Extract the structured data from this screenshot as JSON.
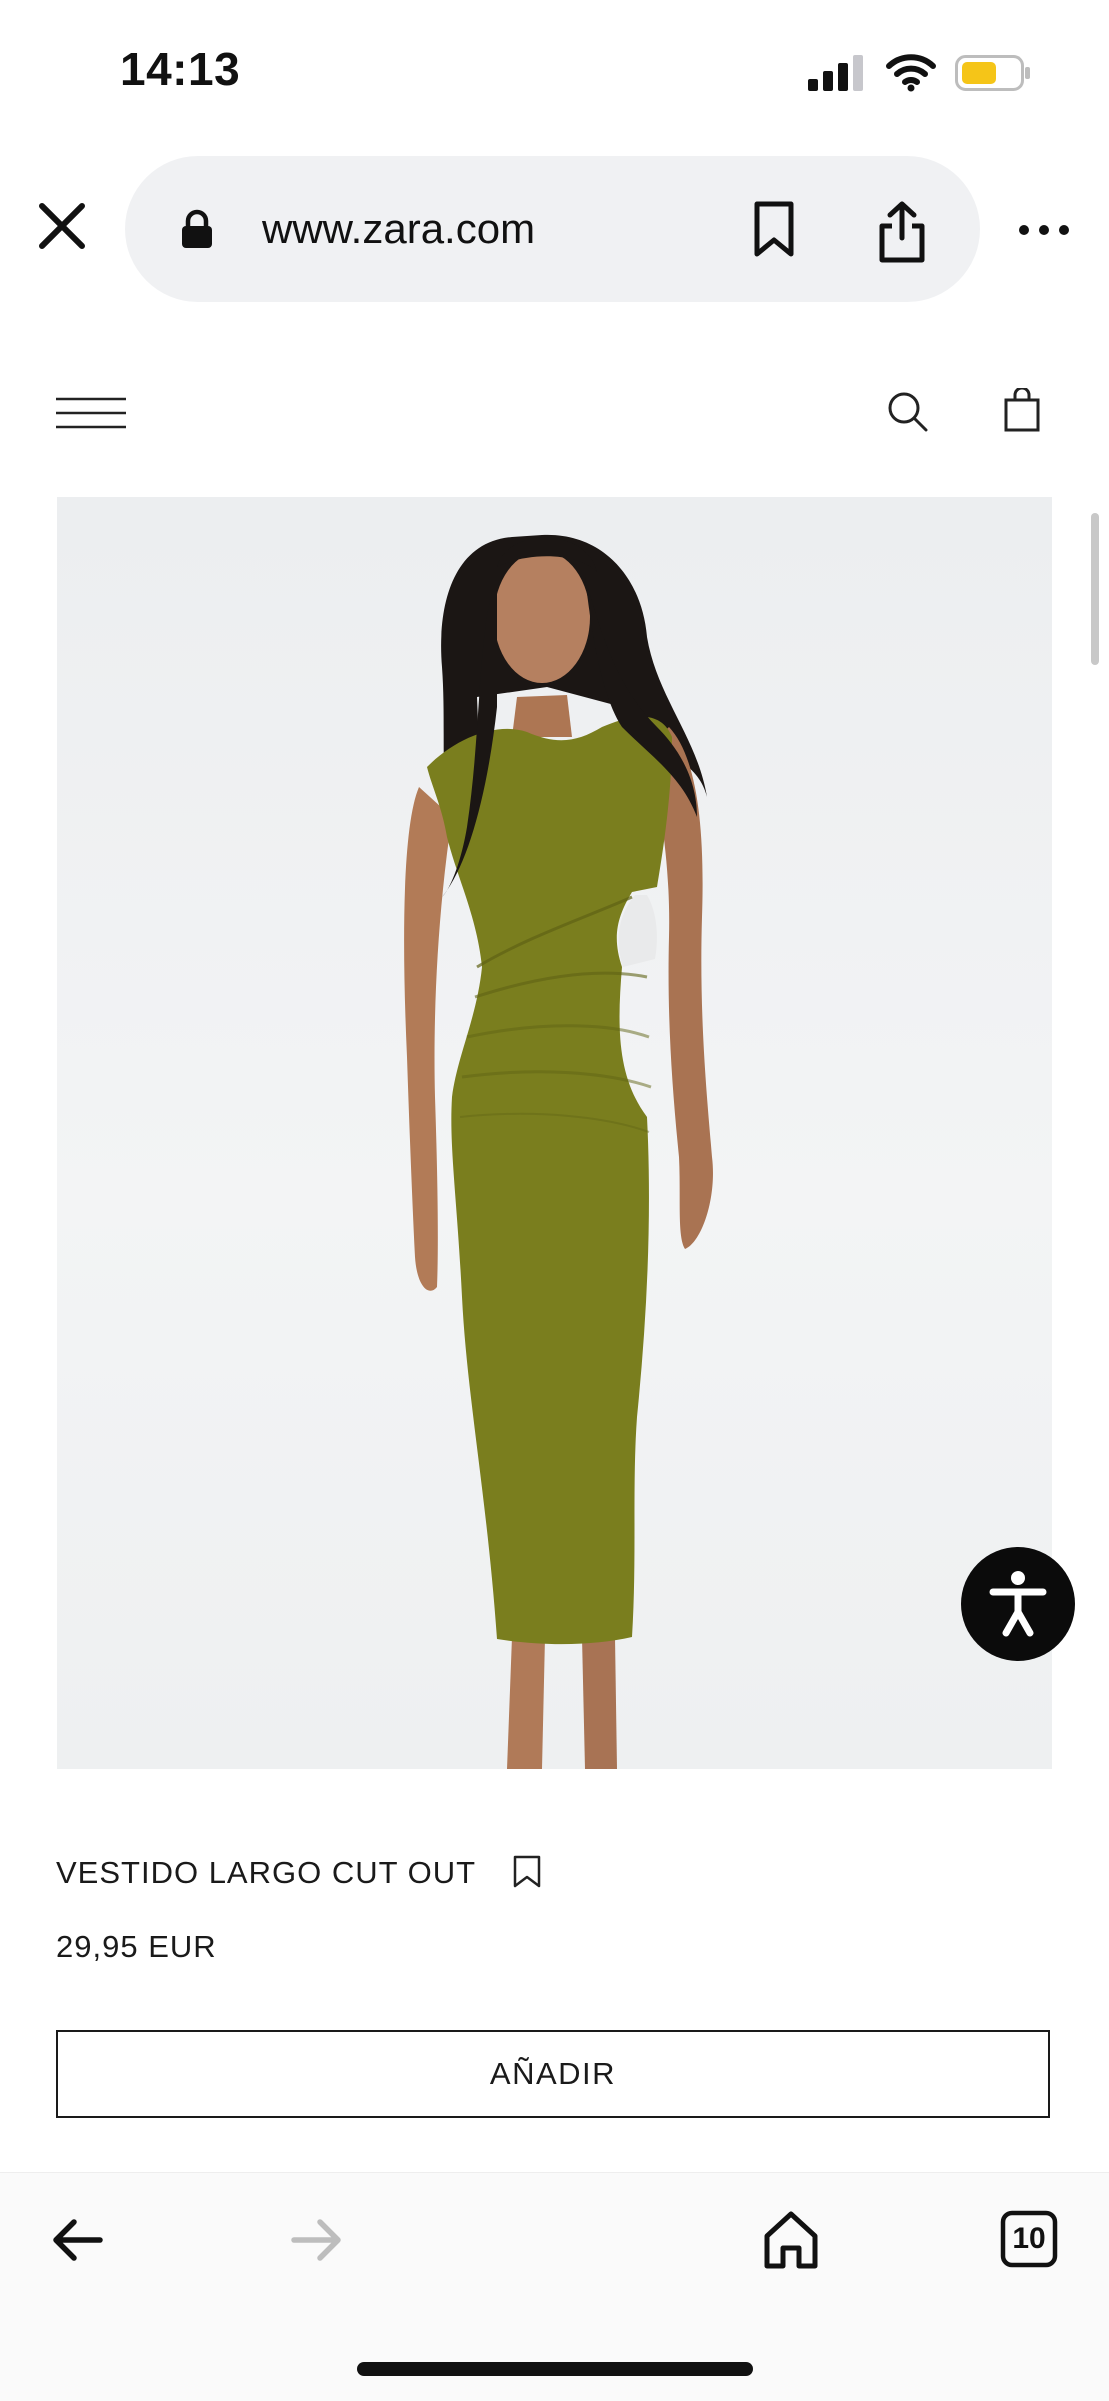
{
  "status_bar": {
    "time": "14:13",
    "battery_color": "#f5c518"
  },
  "browser": {
    "url": "www.zara.com",
    "icons": {
      "close": "close-icon",
      "lock": "lock-icon",
      "bookmark": "bookmark-icon",
      "share": "share-icon",
      "more": "more-icon"
    }
  },
  "site_header": {
    "icons": {
      "menu": "hamburger-menu-icon",
      "search": "search-icon",
      "bag": "shopping-bag-icon"
    }
  },
  "product": {
    "name": "VESTIDO LARGO CUT OUT",
    "price": "29,95 EUR",
    "add_label": "AÑADIR",
    "dress_color": "#7a7e1e"
  },
  "toolbar": {
    "tabs_count": "10",
    "icons": {
      "back": "arrow-left-icon",
      "forward": "arrow-right-icon",
      "home": "home-icon",
      "tabs": "tabs-icon"
    }
  }
}
